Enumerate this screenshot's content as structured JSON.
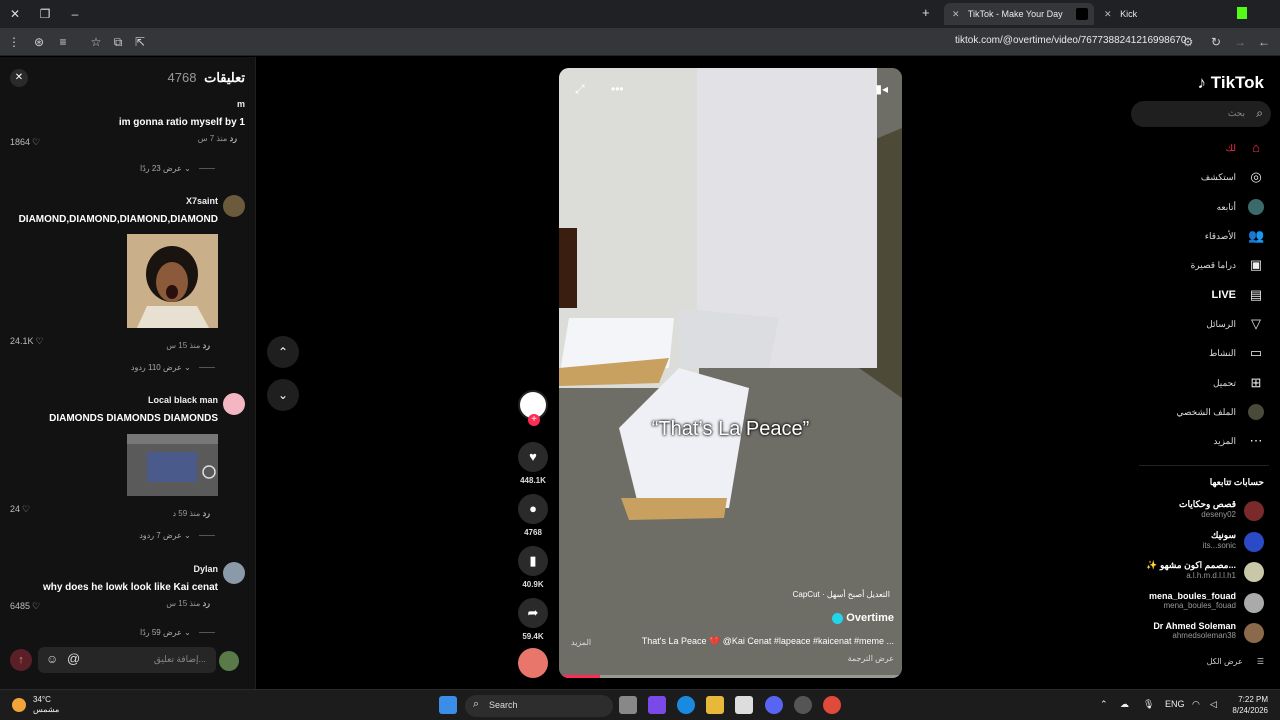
{
  "browser": {
    "tabs": [
      {
        "label": "TikTok - Make Your Day",
        "active": true
      },
      {
        "label": "Kick",
        "active": false
      }
    ],
    "url": "tiktok.com/@overtime/video/7677388241216998670"
  },
  "comments": {
    "title": "تعليقات",
    "count": "4768",
    "items": [
      {
        "user": "m",
        "text": "im gonna ratio myself by 1",
        "time": "منذ 7 س",
        "reply": "رد",
        "likes": "1864",
        "view_replies": "عرض 23 ردًا"
      },
      {
        "user": "X7saint",
        "text": "DIAMOND,DIAMOND,DIAMOND,DIAMOND",
        "time": "منذ 15 س",
        "reply": "رد",
        "likes": "24.1K",
        "view_replies": "عرض 110 ردود"
      },
      {
        "user": "Local black man",
        "text": "DIAMONDS DIAMONDS DIAMONDS",
        "time": "منذ 59 د",
        "reply": "رد",
        "likes": "24",
        "view_replies": "عرض 7 ردود"
      },
      {
        "user": "Dylan",
        "text": "why does he lowk look like Kai cenat",
        "time": "منذ 15 س",
        "reply": "رد",
        "likes": "6485",
        "view_replies": "عرض 59 ردًا"
      }
    ],
    "input_placeholder": "إضافة تعليق...",
    "at_symbol": "@"
  },
  "video": {
    "caption": "“That’s La Peace”",
    "capcut": "CapCut · التعديل أصبح أسهل",
    "author": "Overtime",
    "description": "That's La Peace 💔 @Kai Cenat #lapeace #kaicenat #meme ...",
    "translation": "عرض الترجمة",
    "more": "المزيد",
    "progress": 0.12
  },
  "actions": {
    "likes": "448.1K",
    "comments": "4768",
    "saves": "40.9K",
    "shares": "59.4K"
  },
  "sidebar": {
    "logo": "TikTok",
    "search_placeholder": "بحث",
    "nav": [
      {
        "label": "لك",
        "icon": "home-icon",
        "active": true
      },
      {
        "label": "استكشف",
        "icon": "compass-icon"
      },
      {
        "label": "أتابعه",
        "icon": "following-avatar-icon"
      },
      {
        "label": "الأصدقاء",
        "icon": "friends-icon"
      },
      {
        "label": "دراما قصيرة",
        "icon": "short-drama-icon"
      },
      {
        "label": "LIVE",
        "icon": "live-icon"
      },
      {
        "label": "الرسائل",
        "icon": "send-icon"
      },
      {
        "label": "النشاط",
        "icon": "activity-icon"
      },
      {
        "label": "تحميل",
        "icon": "upload-icon"
      },
      {
        "label": "الملف الشخصي",
        "icon": "profile-icon"
      },
      {
        "label": "المزيد",
        "icon": "more-icon"
      }
    ],
    "following_title": "حسابات تتابعها",
    "following": [
      {
        "name": "قصص وحكايات",
        "handle": "deseny02"
      },
      {
        "name": "سونيك",
        "handle": "its...sonic"
      },
      {
        "name": "✨ مصمم اكون مشهو...",
        "handle": "a.l.h.m.d.l.l.h1"
      },
      {
        "name": "mena_boules_fouad",
        "handle": "mena_boules_fouad"
      },
      {
        "name": "Dr Ahmed Soleman",
        "handle": "ahmedsoleman38"
      }
    ],
    "see_all": "عرض الكل"
  },
  "taskbar": {
    "temp": "34°C",
    "weather": "مشمس",
    "search": "Search",
    "lang": "ENG",
    "time": "7:22 PM",
    "date": "8/24/2026"
  }
}
